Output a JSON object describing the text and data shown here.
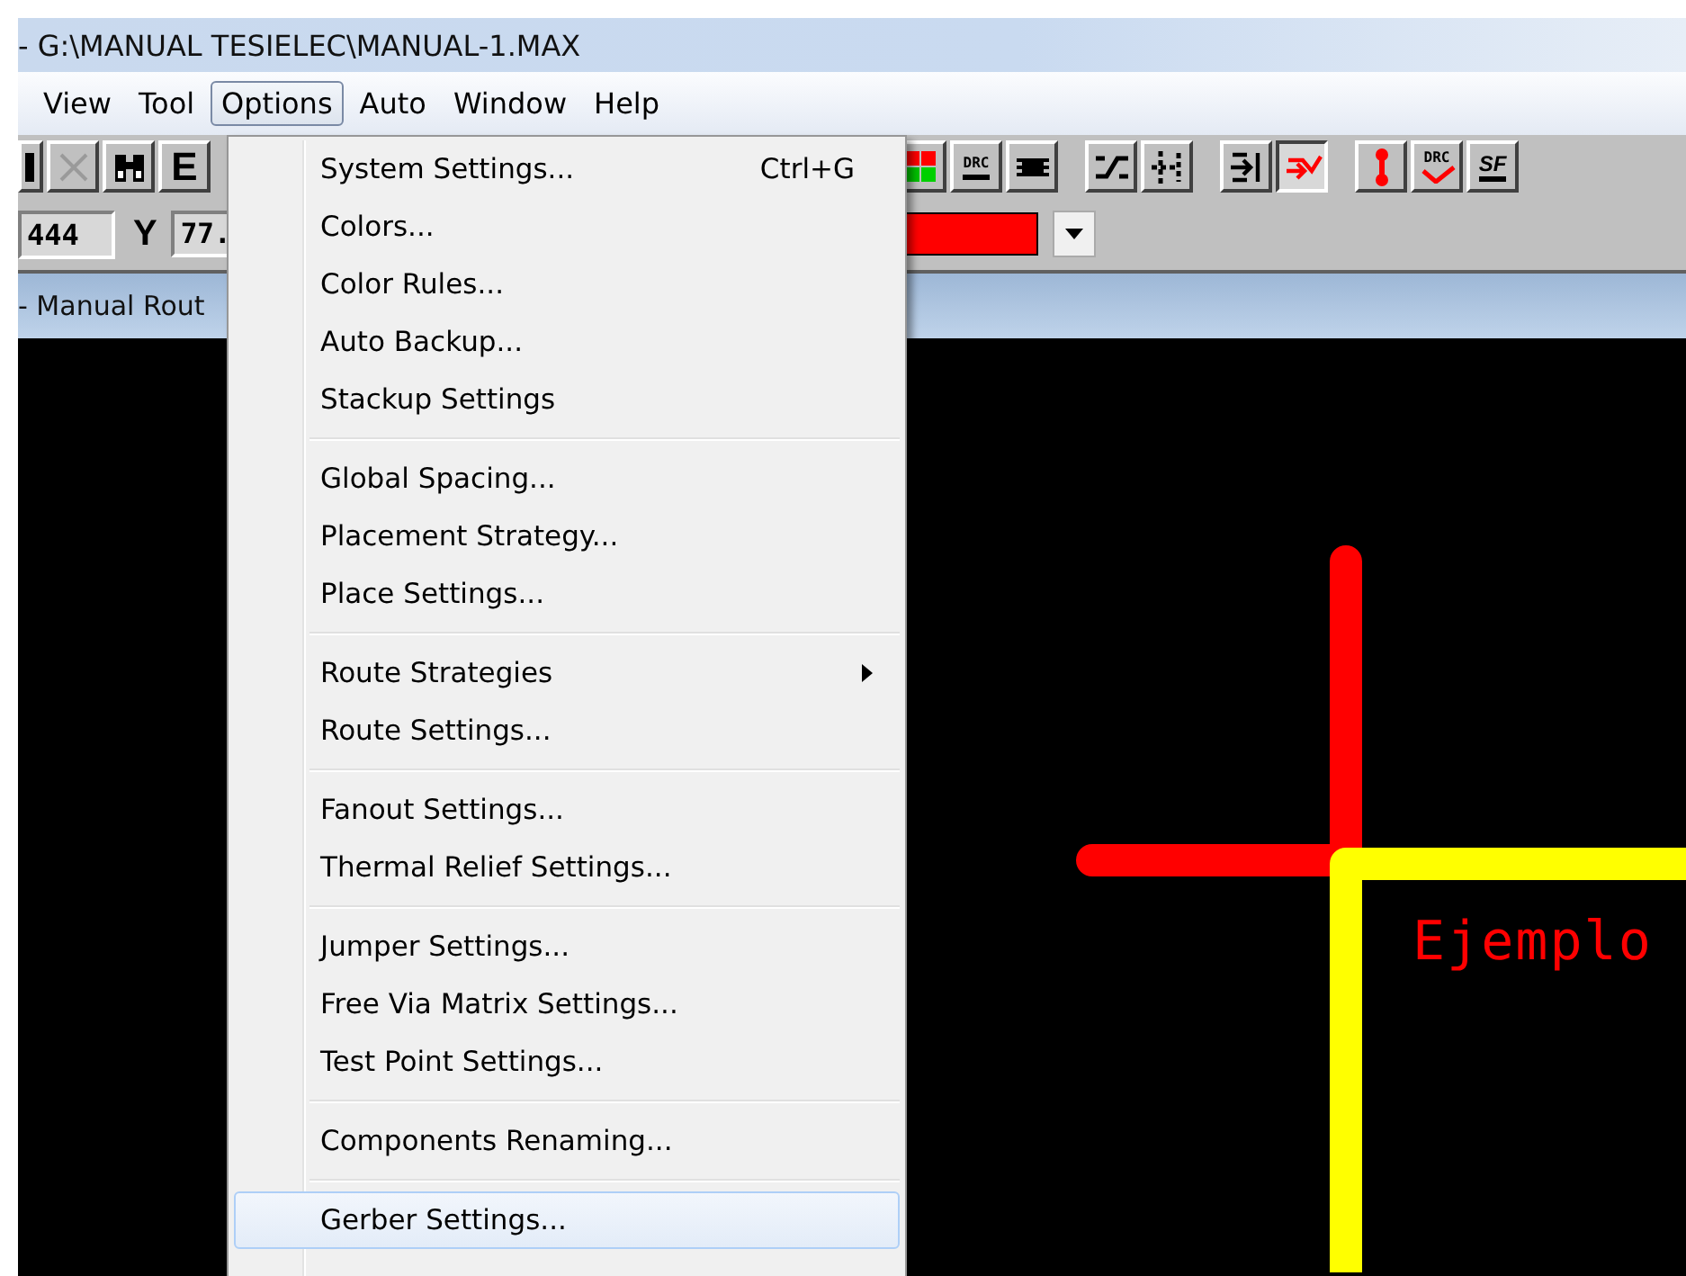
{
  "window": {
    "title": "- G:\\MANUAL TESIELEC\\MANUAL-1.MAX"
  },
  "menu_bar": [
    {
      "label": "View",
      "selected": false
    },
    {
      "label": "Tool",
      "selected": false
    },
    {
      "label": "Options",
      "selected": true
    },
    {
      "label": "Auto",
      "selected": false
    },
    {
      "label": "Window",
      "selected": false
    },
    {
      "label": "Help",
      "selected": false
    }
  ],
  "toolbar_left": [
    {
      "kind": "glyph"
    },
    {
      "kind": "close",
      "disabled": true
    },
    {
      "kind": "binoculars"
    },
    {
      "kind": "text",
      "label": "E"
    }
  ],
  "toolbar_right": [
    {
      "kind": "colors",
      "selected": false
    },
    {
      "kind": "drc",
      "label": "DRC",
      "selected": false
    },
    {
      "kind": "chip",
      "selected": false
    },
    {
      "kind": "gap"
    },
    {
      "kind": "route",
      "selected": false
    },
    {
      "kind": "split",
      "selected": false
    },
    {
      "kind": "gap"
    },
    {
      "kind": "enter",
      "selected": false
    },
    {
      "kind": "redroute",
      "selected": true
    },
    {
      "kind": "gap"
    },
    {
      "kind": "via",
      "selected": false
    },
    {
      "kind": "drccheck",
      "label": "DRC",
      "selected": false
    },
    {
      "kind": "sf",
      "label": "SF",
      "selected": false
    }
  ],
  "coordinates": {
    "x_value": "444",
    "y_label": "Y",
    "y_value": "77."
  },
  "document": {
    "title": "- Manual Rout"
  },
  "canvas": {
    "label": "Ejemplo"
  },
  "options_menu": [
    {
      "kind": "item",
      "label": "System Settings...",
      "shortcut": "Ctrl+G",
      "selected": false
    },
    {
      "kind": "item",
      "label": "Colors...",
      "selected": false
    },
    {
      "kind": "item",
      "label": "Color Rules...",
      "selected": false
    },
    {
      "kind": "item",
      "label": "Auto Backup...",
      "selected": false
    },
    {
      "kind": "item",
      "label": "Stackup Settings",
      "selected": false
    },
    {
      "kind": "separator"
    },
    {
      "kind": "item",
      "label": "Global Spacing...",
      "selected": false
    },
    {
      "kind": "item",
      "label": "Placement Strategy...",
      "selected": false
    },
    {
      "kind": "item",
      "label": "Place Settings...",
      "selected": false
    },
    {
      "kind": "separator"
    },
    {
      "kind": "submenu",
      "label": "Route Strategies",
      "selected": false
    },
    {
      "kind": "item",
      "label": "Route Settings...",
      "selected": false
    },
    {
      "kind": "separator"
    },
    {
      "kind": "item",
      "label": "Fanout Settings...",
      "selected": false
    },
    {
      "kind": "item",
      "label": "Thermal Relief Settings...",
      "selected": false
    },
    {
      "kind": "separator"
    },
    {
      "kind": "item",
      "label": "Jumper Settings...",
      "selected": false
    },
    {
      "kind": "item",
      "label": "Free Via Matrix Settings...",
      "selected": false
    },
    {
      "kind": "item",
      "label": "Test Point Settings...",
      "selected": false
    },
    {
      "kind": "separator"
    },
    {
      "kind": "item",
      "label": "Components Renaming...",
      "selected": false
    },
    {
      "kind": "separator"
    },
    {
      "kind": "item",
      "label": "Gerber Settings...",
      "selected": true
    }
  ]
}
